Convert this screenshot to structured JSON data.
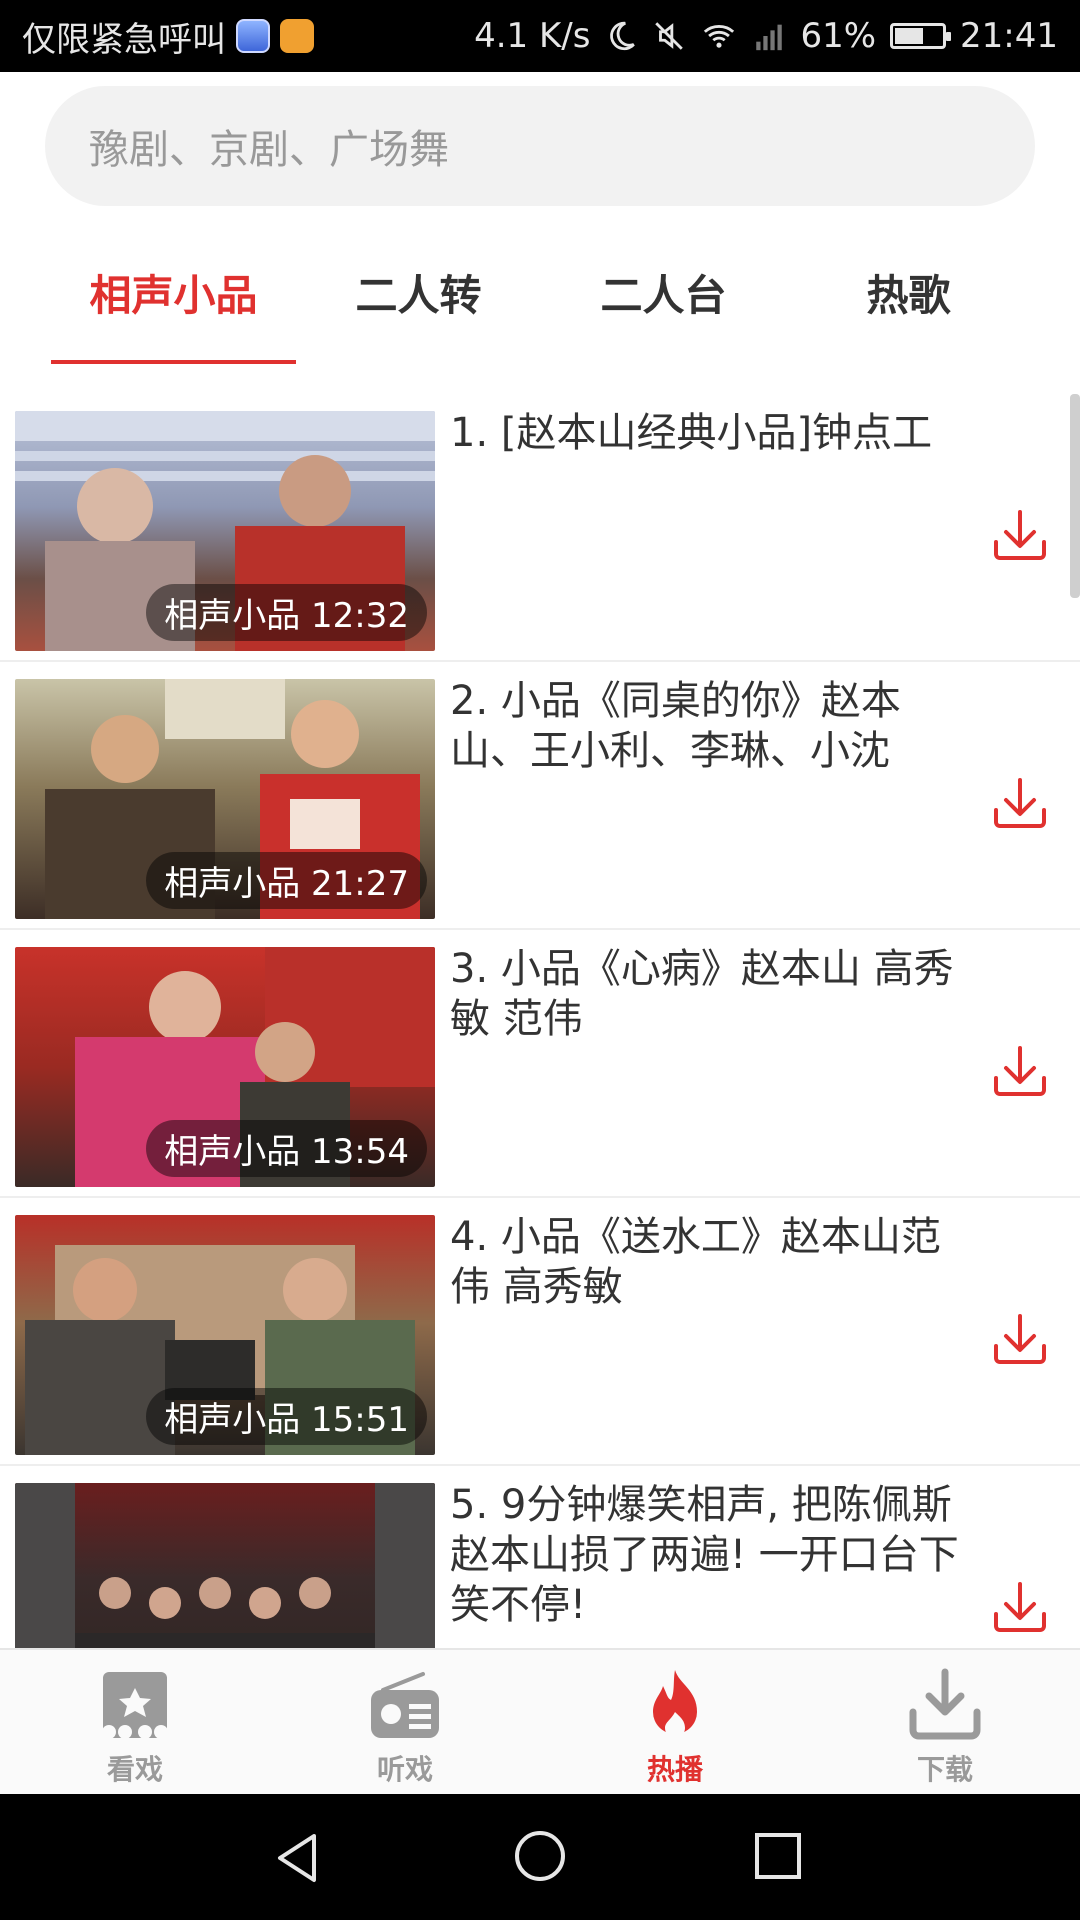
{
  "status_bar": {
    "left_text": "仅限紧急呼叫",
    "speed": "4.1 K/s",
    "battery": "61%",
    "time": "21:41",
    "battery_level_percent": 61
  },
  "search": {
    "placeholder": "豫剧、京剧、广场舞"
  },
  "tabs": [
    {
      "label": "相声小品",
      "active": true
    },
    {
      "label": "二人转"
    },
    {
      "label": "二人台"
    },
    {
      "label": "热歌"
    }
  ],
  "videos": [
    {
      "title": "1. [赵本山经典小品]钟点工",
      "caption": "相声小品 12:32"
    },
    {
      "title": "2. 小品《同桌的你》赵本山、王小利、李琳、小沈",
      "caption": "相声小品 21:27"
    },
    {
      "title": "3. 小品《心病》赵本山 高秀敏 范伟",
      "caption": "相声小品 13:54"
    },
    {
      "title": "4. 小品《送水工》赵本山范伟 高秀敏",
      "caption": "相声小品 15:51"
    },
    {
      "title": "5. 9分钟爆笑相声, 把陈佩斯赵本山损了两遍! 一开口台下笑不停!",
      "caption": ""
    }
  ],
  "bottom_nav": [
    {
      "label": "看戏",
      "icon": "theater-icon"
    },
    {
      "label": "听戏",
      "icon": "radio-icon"
    },
    {
      "label": "热播",
      "icon": "flame-icon",
      "active": true
    },
    {
      "label": "下载",
      "icon": "download-icon"
    }
  ],
  "colors": {
    "accent": "#e0312f",
    "inactive": "#9a9a9a"
  }
}
